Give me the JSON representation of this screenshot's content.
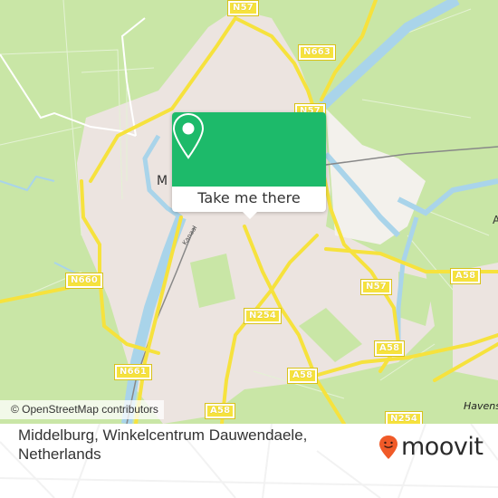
{
  "map": {
    "place_labels": {
      "city_initial": "M",
      "havens": "Havens",
      "east_edge": "A",
      "canal": "Kanaal"
    },
    "road_shields": [
      {
        "id": "n57-top",
        "label": "N57"
      },
      {
        "id": "n663",
        "label": "N663"
      },
      {
        "id": "n57-mid",
        "label": "N57"
      },
      {
        "id": "n660",
        "label": "N660"
      },
      {
        "id": "n254",
        "label": "N254"
      },
      {
        "id": "n57-right",
        "label": "N57"
      },
      {
        "id": "a58-right",
        "label": "A58"
      },
      {
        "id": "a58-east",
        "label": "A58"
      },
      {
        "id": "n661",
        "label": "N661"
      },
      {
        "id": "a58-center",
        "label": "A58"
      },
      {
        "id": "a58-bottom",
        "label": "A58"
      },
      {
        "id": "n254-bottom",
        "label": "N254"
      }
    ],
    "attribution": "© OpenStreetMap contributors",
    "colors": {
      "land": "#c9e6a6",
      "urban": "#ece4e0",
      "water": "#a9d4ea",
      "road": "#f6e23d"
    }
  },
  "popup": {
    "icon": "location-pin-icon",
    "button_label": "Take me there",
    "color": "#1dba6a"
  },
  "footer": {
    "title": "Middelburg, Winkelcentrum Dauwendaele, Netherlands",
    "brand": "moovit",
    "brand_color": "#f05a28"
  }
}
